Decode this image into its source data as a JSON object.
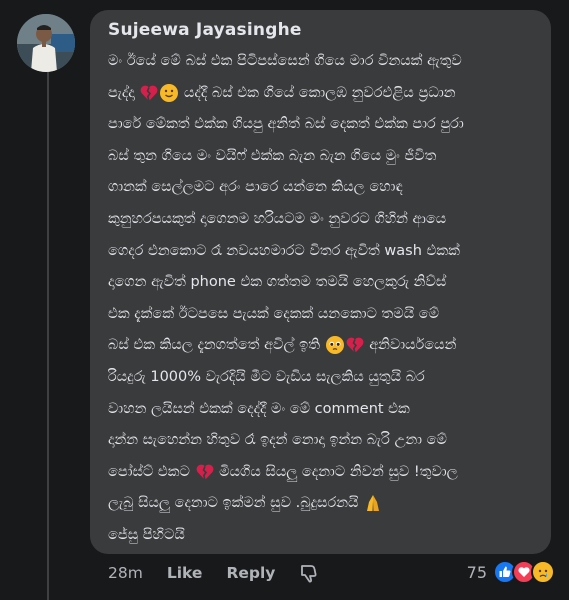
{
  "comment": {
    "author": "Sujeewa Jayasinghe",
    "lines": [
      "මං ඊයේ මේ බස් එක පිටිපස්සෙන් ගියෙ මාර විනයක් ඇතුව",
      "පැද්දා",
      "යද්දී බස් එක ගියේ කොලඹ නුවරඑළිය ප්‍රධාන",
      "පාරේ මේකත් එක්ක ගියපු අනිත් බස් දෙකත් එක්ක පාර පුරා",
      "බස් තුන ගියෙ මං වයිෆ් එක්ක බැන බැන ගියෙ මුං ජීවිත",
      "ගානක් සෙල්ලමට අරං පාරෙ යන්නෙ කියල හොඳ",
      "කුනුහරපයකුත් දාගෙනම හරියටම මං නුවරට ගිහින් ආයෙ",
      "ගෙදර එනකොට රෑ නවයහමාරට විතර ඇවිත් wash එකක්",
      "දාගෙන ඇවිත් phone එක ගත්තම තමයි හෙලකුරු නිව්ස්",
      "එක දැක්කේ ඊටපසෙ පැයක් දෙකක් යනකොට තමයි මේ",
      "බස් එක කියල දැනගත්තේ අවිල් ඉති",
      "අනිවාර්යයෙන්",
      "රියදුරු 1000% වැරදියි මීට වැඩිය සැලකිය යුතුයි බර",
      "වාහන ලයිසන් එකක් දෙද්දී මං මේ comment එක",
      "දාන්න සැහෙන්න හිතුව රෑ ඉදන් නොදා ඉන්න බැරි උනා මේ",
      "පෝස්ට් එකට",
      "මියගිය සියලු දෙනාට නිවන් සුව !තුවාල",
      "ලැබු සියලු දෙනාට ඉක්මන් සුව .බුදුසරනයි",
      "ජේසු පිහිටයි"
    ]
  },
  "footer": {
    "time": "28m",
    "like": "Like",
    "reply": "Reply"
  },
  "reactions": {
    "count": "75",
    "icons": [
      "like-icon",
      "love-icon",
      "sad-icon"
    ]
  },
  "emoji": {
    "broken_heart": "broken-heart-icon",
    "slight_smile": "slight-smile-icon",
    "pleading_face": "pleading-face-icon",
    "folded_hands": "folded-hands-icon"
  },
  "colors": {
    "background": "#18191a",
    "bubble": "#3a3b3c",
    "text": "#e4e6eb",
    "muted": "#b0b3b8",
    "like_blue": "#1877f2",
    "love_red": "#f33e58",
    "broken_heart": "#d6204c",
    "emoji_yellow": "#f7b928"
  }
}
